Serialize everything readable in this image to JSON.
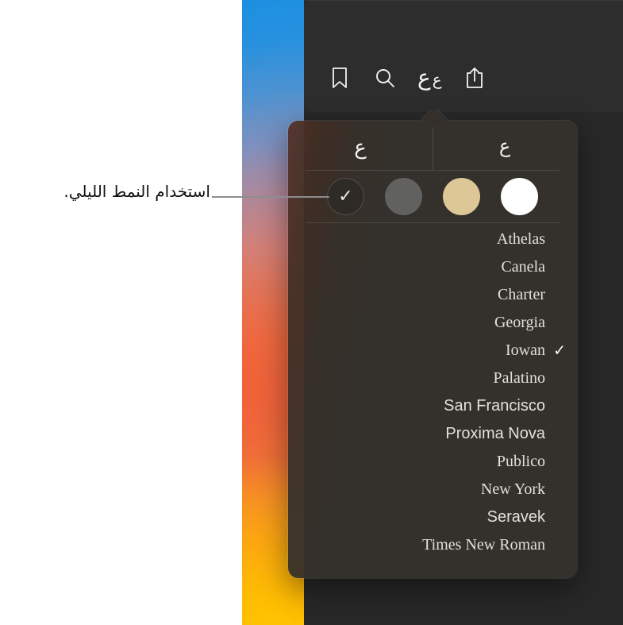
{
  "callout": {
    "text": "استخدام النمط الليلي.",
    "line": "callout-leader-line"
  },
  "toolbar": {
    "icons": [
      {
        "name": "bookmark-icon",
        "label": "Bookmark"
      },
      {
        "name": "search-icon",
        "label": "Search"
      },
      {
        "name": "font-size-icon",
        "label": "ع ع",
        "big": "ع",
        "small": "ع"
      },
      {
        "name": "share-icon",
        "label": "Share"
      }
    ]
  },
  "popover": {
    "size_controls": {
      "decrease_label": "ع",
      "increase_label": "ع"
    },
    "themes": [
      {
        "name": "theme-dark",
        "color": "#2e2a26",
        "selected": true,
        "check": "✓"
      },
      {
        "name": "theme-gray",
        "color": "#616160",
        "selected": false,
        "check": ""
      },
      {
        "name": "theme-sepia",
        "color": "#ddc796",
        "selected": false,
        "check": ""
      },
      {
        "name": "theme-white",
        "color": "#ffffff",
        "selected": false,
        "check": ""
      }
    ],
    "fonts": [
      {
        "label": "Athelas",
        "style": "serif",
        "selected": false,
        "check": ""
      },
      {
        "label": "Canela",
        "style": "serif",
        "selected": false,
        "check": ""
      },
      {
        "label": "Charter",
        "style": "serif",
        "selected": false,
        "check": ""
      },
      {
        "label": "Georgia",
        "style": "serif",
        "selected": false,
        "check": ""
      },
      {
        "label": "Iowan",
        "style": "serif",
        "selected": true,
        "check": "✓"
      },
      {
        "label": "Palatino",
        "style": "serif",
        "selected": false,
        "check": ""
      },
      {
        "label": "San Francisco",
        "style": "sans",
        "selected": false,
        "check": ""
      },
      {
        "label": "Proxima Nova",
        "style": "sans",
        "selected": false,
        "check": ""
      },
      {
        "label": "Publico",
        "style": "serif",
        "selected": false,
        "check": ""
      },
      {
        "label": "New York",
        "style": "serif",
        "selected": false,
        "check": ""
      },
      {
        "label": "Seravek",
        "style": "sans",
        "selected": false,
        "check": ""
      },
      {
        "label": "Times New Roman",
        "style": "serif",
        "selected": false,
        "check": ""
      }
    ]
  },
  "colors": {
    "window_background": "#282828",
    "toolbar_background": "#2d2d2d",
    "popover_background": "#352f2b",
    "accent_sepia": "#ddc796",
    "text_primary": "#e3e0db"
  }
}
